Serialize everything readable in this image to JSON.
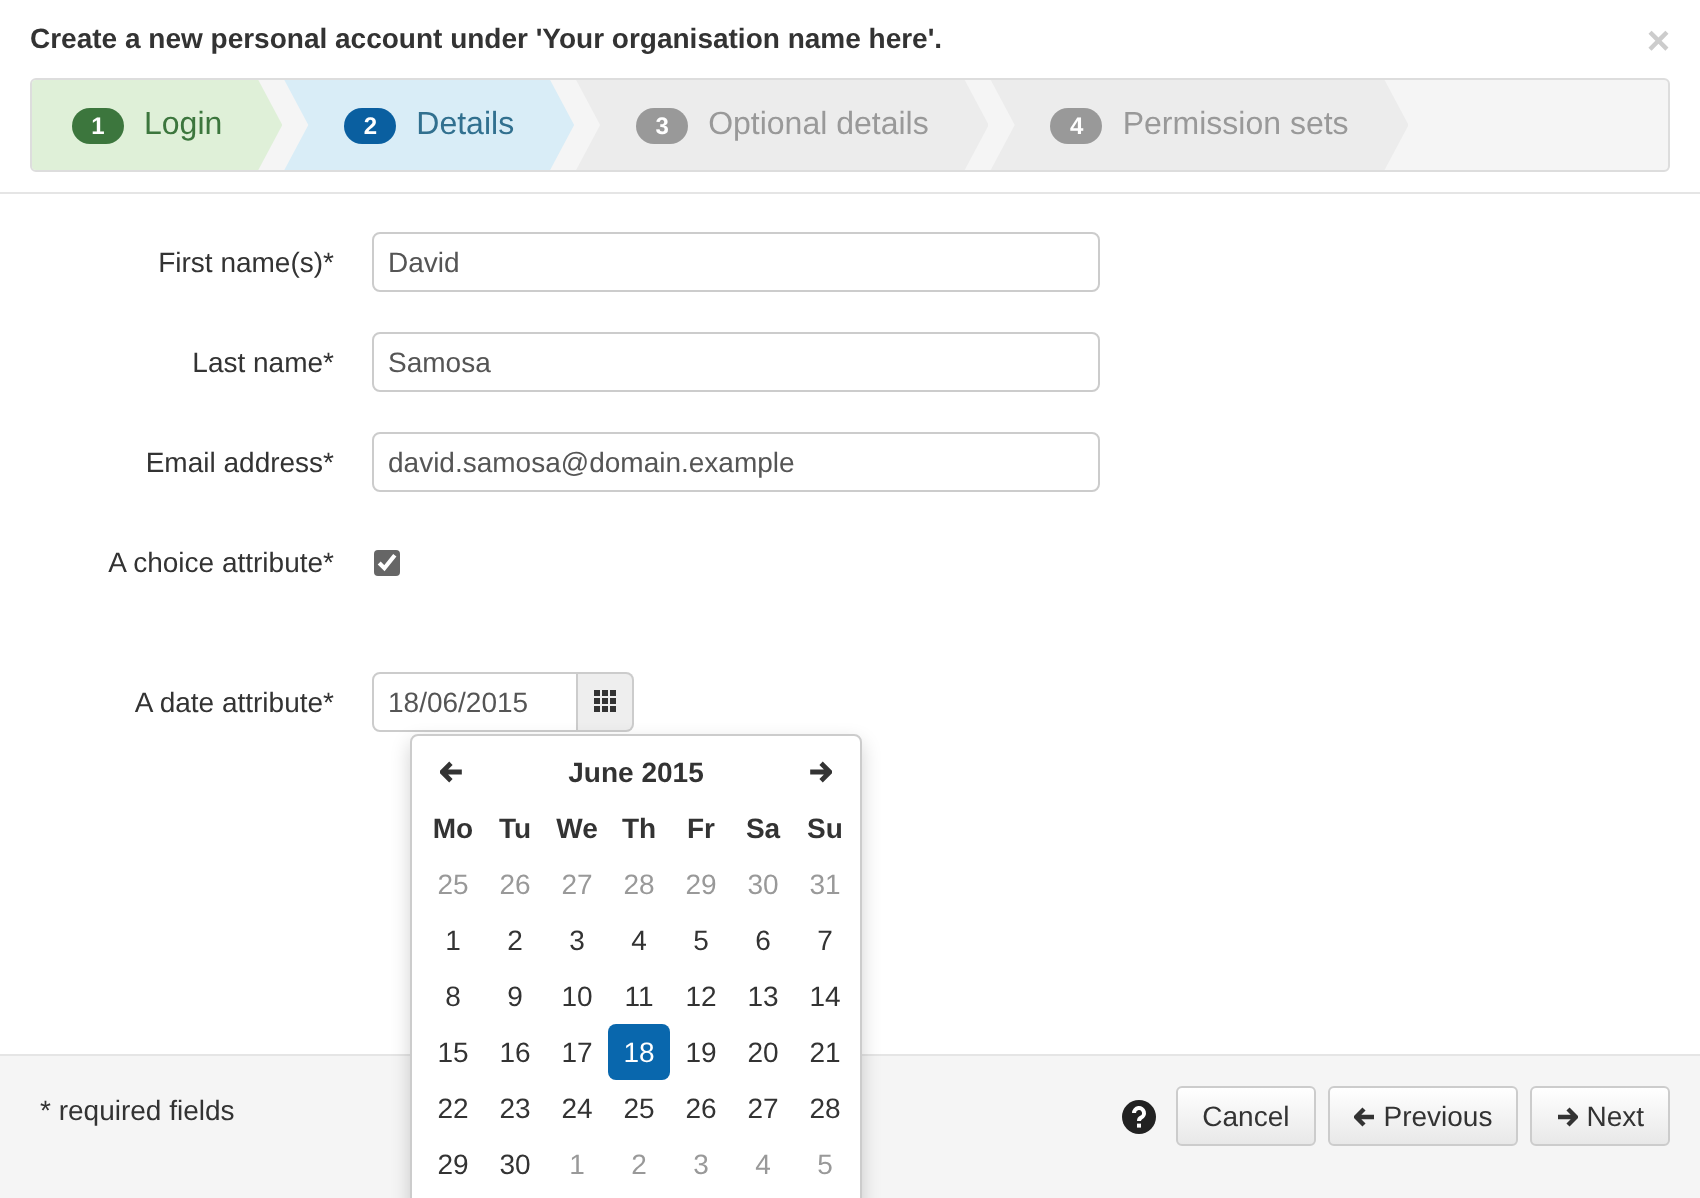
{
  "dialog": {
    "title": "Create a new personal account under 'Your organisation name here'.",
    "close": "×"
  },
  "steps": [
    {
      "number": "1",
      "label": "Login",
      "done": true,
      "selected": false
    },
    {
      "number": "2",
      "label": "Details",
      "done": false,
      "selected": true
    },
    {
      "number": "3",
      "label": "Optional details",
      "done": false,
      "selected": false
    },
    {
      "number": "4",
      "label": "Permission sets",
      "done": false,
      "selected": false
    }
  ],
  "fields": [
    {
      "kind": "text",
      "label": "First name(s)*",
      "value": "David"
    },
    {
      "kind": "text",
      "label": "Last name*",
      "value": "Samosa"
    },
    {
      "kind": "text",
      "label": "Email address*",
      "value": "david.samosa@domain.example"
    },
    {
      "kind": "checkbox",
      "label": "A choice attribute*",
      "checked": true
    },
    {
      "kind": "date",
      "label": "A date attribute*",
      "value": "18/06/2015"
    }
  ],
  "calendar": {
    "month": "June 2015",
    "weekdays": [
      "Mo",
      "Tu",
      "We",
      "Th",
      "Fr",
      "Sa",
      "Su"
    ],
    "weeks": [
      [
        {
          "day": "25",
          "outside": true,
          "selected": false
        },
        {
          "day": "26",
          "outside": true,
          "selected": false
        },
        {
          "day": "27",
          "outside": true,
          "selected": false
        },
        {
          "day": "28",
          "outside": true,
          "selected": false
        },
        {
          "day": "29",
          "outside": true,
          "selected": false
        },
        {
          "day": "30",
          "outside": true,
          "selected": false
        },
        {
          "day": "31",
          "outside": true,
          "selected": false
        }
      ],
      [
        {
          "day": "1",
          "outside": false,
          "selected": false
        },
        {
          "day": "2",
          "outside": false,
          "selected": false
        },
        {
          "day": "3",
          "outside": false,
          "selected": false
        },
        {
          "day": "4",
          "outside": false,
          "selected": false
        },
        {
          "day": "5",
          "outside": false,
          "selected": false
        },
        {
          "day": "6",
          "outside": false,
          "selected": false
        },
        {
          "day": "7",
          "outside": false,
          "selected": false
        }
      ],
      [
        {
          "day": "8",
          "outside": false,
          "selected": false
        },
        {
          "day": "9",
          "outside": false,
          "selected": false
        },
        {
          "day": "10",
          "outside": false,
          "selected": false
        },
        {
          "day": "11",
          "outside": false,
          "selected": false
        },
        {
          "day": "12",
          "outside": false,
          "selected": false
        },
        {
          "day": "13",
          "outside": false,
          "selected": false
        },
        {
          "day": "14",
          "outside": false,
          "selected": false
        }
      ],
      [
        {
          "day": "15",
          "outside": false,
          "selected": false
        },
        {
          "day": "16",
          "outside": false,
          "selected": false
        },
        {
          "day": "17",
          "outside": false,
          "selected": false
        },
        {
          "day": "18",
          "outside": false,
          "selected": true
        },
        {
          "day": "19",
          "outside": false,
          "selected": false
        },
        {
          "day": "20",
          "outside": false,
          "selected": false
        },
        {
          "day": "21",
          "outside": false,
          "selected": false
        }
      ],
      [
        {
          "day": "22",
          "outside": false,
          "selected": false
        },
        {
          "day": "23",
          "outside": false,
          "selected": false
        },
        {
          "day": "24",
          "outside": false,
          "selected": false
        },
        {
          "day": "25",
          "outside": false,
          "selected": false
        },
        {
          "day": "26",
          "outside": false,
          "selected": false
        },
        {
          "day": "27",
          "outside": false,
          "selected": false
        },
        {
          "day": "28",
          "outside": false,
          "selected": false
        }
      ],
      [
        {
          "day": "29",
          "outside": false,
          "selected": false
        },
        {
          "day": "30",
          "outside": false,
          "selected": false
        },
        {
          "day": "1",
          "outside": true,
          "selected": false
        },
        {
          "day": "2",
          "outside": true,
          "selected": false
        },
        {
          "day": "3",
          "outside": true,
          "selected": false
        },
        {
          "day": "4",
          "outside": true,
          "selected": false
        },
        {
          "day": "5",
          "outside": true,
          "selected": false
        }
      ]
    ]
  },
  "footer": {
    "note": "* required fields",
    "buttons": [
      {
        "kind": "cancel",
        "label": "Cancel"
      },
      {
        "kind": "previous",
        "label": "Previous"
      },
      {
        "kind": "next",
        "label": "Next"
      }
    ]
  }
}
